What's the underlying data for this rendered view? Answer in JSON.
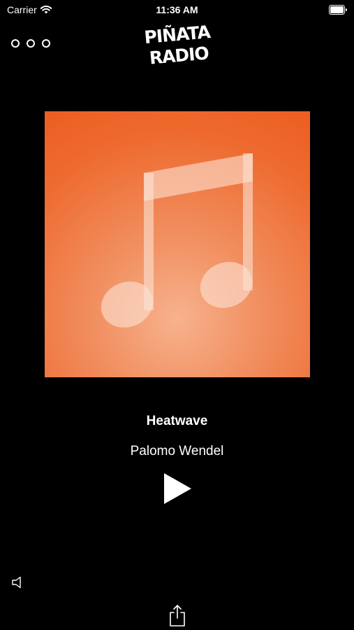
{
  "status_bar": {
    "carrier": "Carrier",
    "time": "11:36 AM",
    "wifi_icon": "wifi-icon",
    "battery_icon": "battery-icon"
  },
  "header": {
    "menu_icon": "more-options-icon",
    "logo_line1": "PIÑATA",
    "logo_line2": "RADIO"
  },
  "player": {
    "artwork_icon": "music-note-icon",
    "title": "Heatwave",
    "artist": "Palomo Wendel",
    "play_icon": "play-icon"
  },
  "footer": {
    "volume_icon": "speaker-icon",
    "share_icon": "share-icon"
  },
  "colors": {
    "background": "#000000",
    "artwork_orange": "#ec5d22",
    "text": "#ffffff"
  }
}
